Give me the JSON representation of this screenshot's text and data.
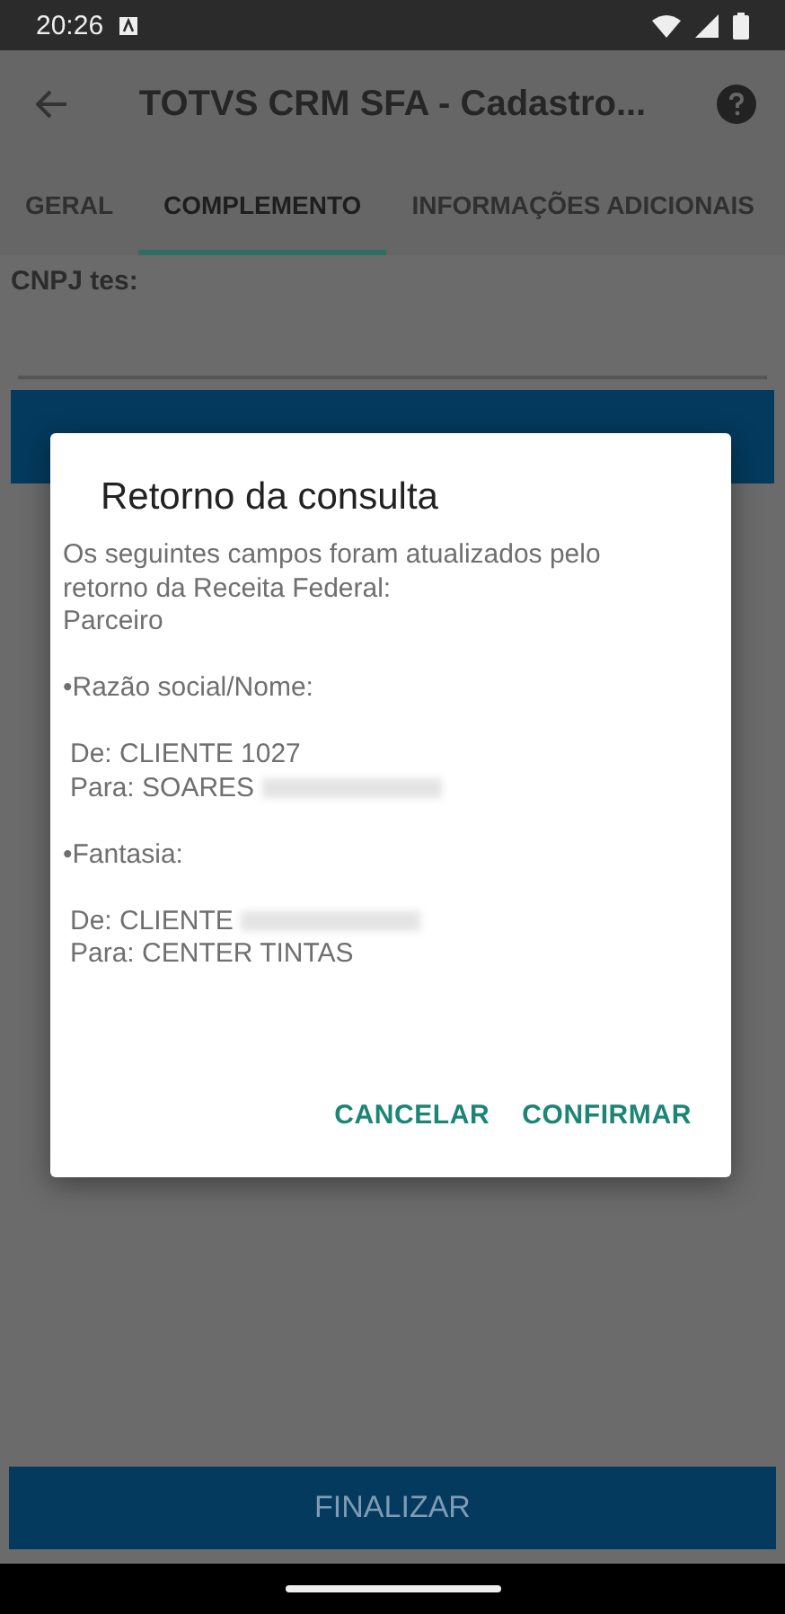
{
  "status_bar": {
    "time": "20:26"
  },
  "app_bar": {
    "title": "TOTVS CRM SFA - Cadastro..."
  },
  "tabs": [
    {
      "label": "GERAL",
      "selected": false
    },
    {
      "label": "COMPLEMENTO",
      "selected": true
    },
    {
      "label": "INFORMAÇÕES ADICIONAIS",
      "selected": false
    }
  ],
  "form": {
    "label": "CNPJ tes:"
  },
  "footer_button": "FINALIZAR",
  "dialog": {
    "title": "Retorno da consulta",
    "blocks": [
      [
        {
          "kind": "plain",
          "text": "Os seguintes campos foram atualizados pelo retorno da Receita Federal:",
          "redacted": false
        },
        {
          "kind": "plain",
          "text": "Parceiro",
          "redacted": false
        }
      ],
      [
        {
          "kind": "plain",
          "text": "•Razão social/Nome:",
          "redacted": false
        }
      ],
      [
        {
          "kind": "detail",
          "text": "De: CLIENTE 1027",
          "redacted": false
        },
        {
          "kind": "detail",
          "text": "Para: SOARES",
          "redacted": true
        }
      ],
      [
        {
          "kind": "plain",
          "text": "•Fantasia:",
          "redacted": false
        }
      ],
      [
        {
          "kind": "detail",
          "text": "De: CLIENTE",
          "redacted": true
        },
        {
          "kind": "detail",
          "text": "Para: CENTER TINTAS",
          "redacted": false
        }
      ]
    ],
    "buttons": [
      "CANCELAR",
      "CONFIRMAR"
    ]
  }
}
